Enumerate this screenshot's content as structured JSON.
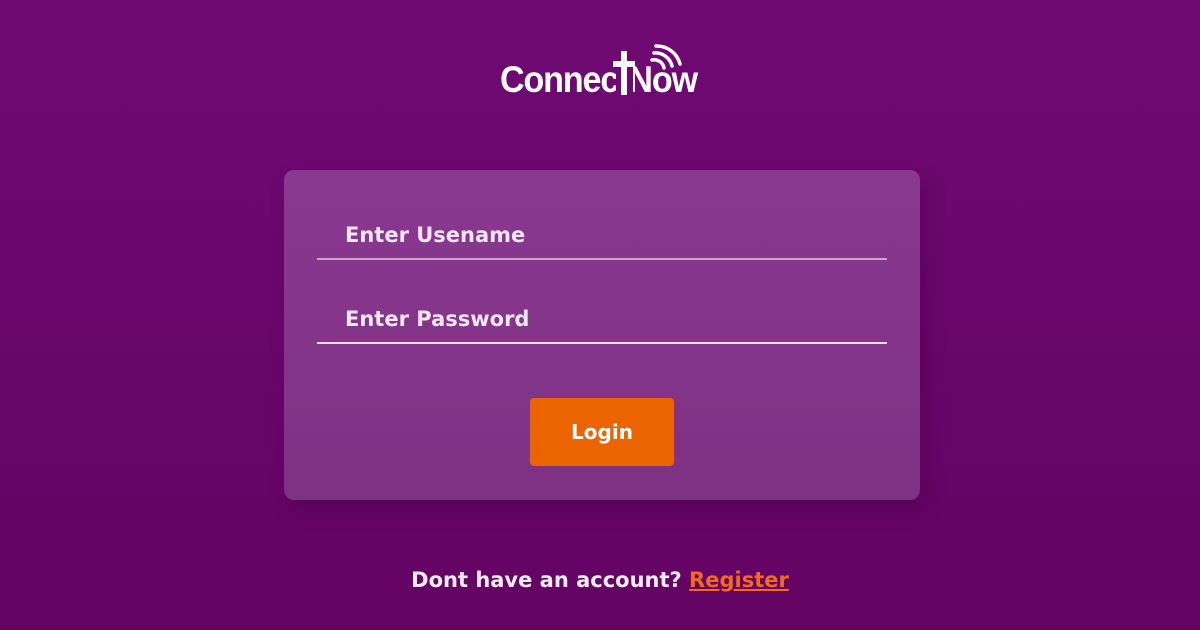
{
  "brand": {
    "name": "ConnectNow",
    "logo_icon": "cross-wifi-icon"
  },
  "login_form": {
    "username_placeholder": "Enter Usename",
    "username_value": "",
    "password_placeholder": "Enter Password",
    "password_value": "",
    "login_label": "Login"
  },
  "footer": {
    "prompt": "Dont have an account?",
    "register_label": "Register"
  },
  "colors": {
    "background": "#6b076e",
    "card": "#843588",
    "accent": "#ec6402",
    "link": "#f26a1b",
    "text": "#ffffff"
  }
}
